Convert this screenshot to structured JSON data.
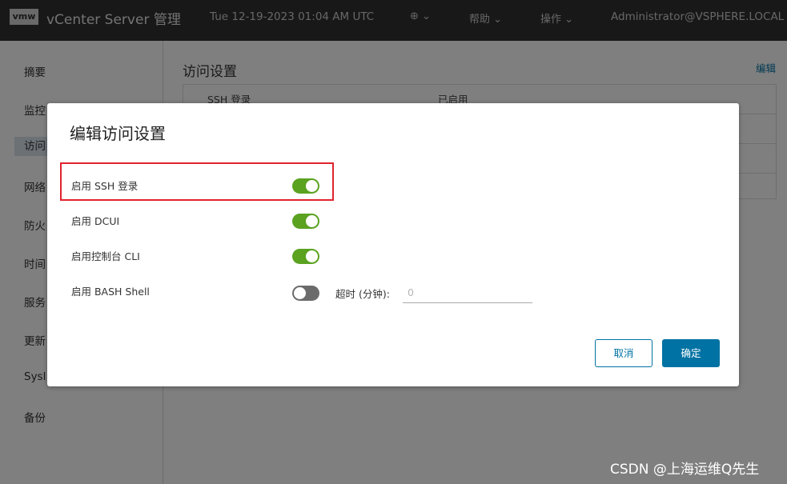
{
  "header": {
    "logo_text": "vmw",
    "app_title": "vCenter Server 管理",
    "datetime": "Tue 12-19-2023 01:04 AM UTC",
    "globe_icon": "⊕",
    "help": "帮助",
    "actions": "操作",
    "user": "Administrator@VSPHERE.LOCAL"
  },
  "sidebar": {
    "items": [
      {
        "label": "摘要"
      },
      {
        "label": "监控"
      },
      {
        "label": "访问"
      },
      {
        "label": "网络"
      },
      {
        "label": "防火"
      },
      {
        "label": "时间"
      },
      {
        "label": "服务"
      },
      {
        "label": "更新"
      },
      {
        "label": "Sysl"
      },
      {
        "label": "备份"
      }
    ]
  },
  "main": {
    "title": "访问设置",
    "edit_link": "编辑",
    "table": {
      "rows": [
        {
          "name": "SSH 登录",
          "value": "已启用"
        }
      ]
    }
  },
  "modal": {
    "title": "编辑访问设置",
    "settings": [
      {
        "label": "启用 SSH 登录",
        "enabled": true
      },
      {
        "label": "启用 DCUI",
        "enabled": true
      },
      {
        "label": "启用控制台 CLI",
        "enabled": true
      },
      {
        "label": "启用 BASH Shell",
        "enabled": false
      }
    ],
    "timeout": {
      "label": "超时 (分钟):",
      "placeholder": "0"
    },
    "cancel_label": "取消",
    "ok_label": "确定"
  },
  "colors": {
    "toggle_on": "#5aa220",
    "toggle_off": "#6b6b6b",
    "primary": "#0072a3",
    "highlight": "#e0242e"
  },
  "watermark": "CSDN @上海运维Q先生"
}
